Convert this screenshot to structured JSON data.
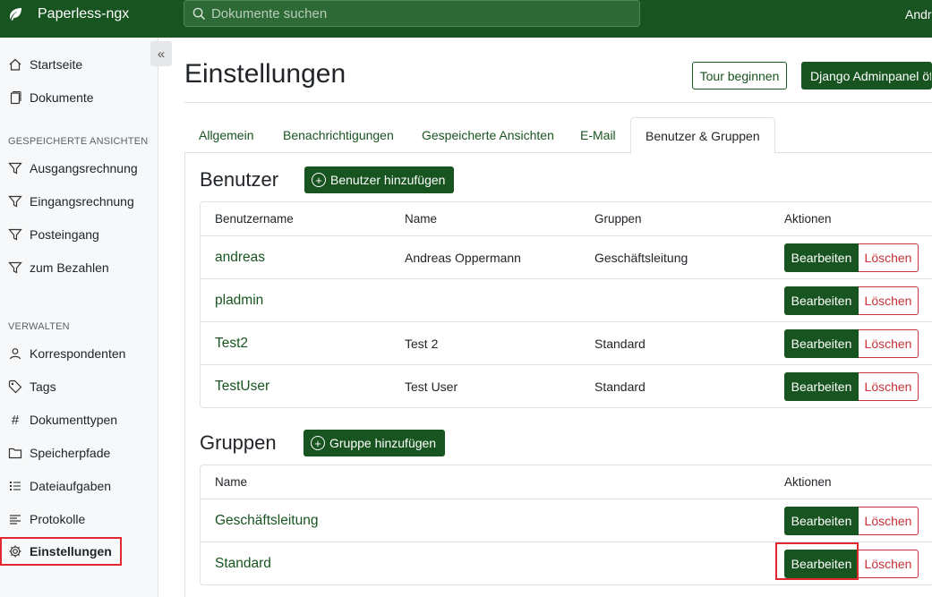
{
  "app": {
    "name": "Paperless-ngx",
    "user_label": "Andreas"
  },
  "search": {
    "placeholder": "Dokumente suchen"
  },
  "sidebar": {
    "top_items": [
      {
        "label": "Startseite",
        "icon": "house-icon"
      },
      {
        "label": "Dokumente",
        "icon": "files-icon"
      }
    ],
    "saved_views_heading": "GESPEICHERTE ANSICHTEN",
    "saved_views": [
      {
        "label": "Ausgangsrechnung",
        "icon": "funnel-icon"
      },
      {
        "label": "Eingangsrechnung",
        "icon": "funnel-icon"
      },
      {
        "label": "Posteingang",
        "icon": "funnel-icon"
      },
      {
        "label": "zum Bezahlen",
        "icon": "funnel-icon"
      }
    ],
    "manage_heading": "VERWALTEN",
    "manage": [
      {
        "label": "Korrespondenten",
        "icon": "person-icon"
      },
      {
        "label": "Tags",
        "icon": "tag-icon"
      },
      {
        "label": "Dokumenttypen",
        "icon": "hash-icon"
      },
      {
        "label": "Speicherpfade",
        "icon": "folder-icon"
      },
      {
        "label": "Dateiaufgaben",
        "icon": "list-task-icon"
      },
      {
        "label": "Protokolle",
        "icon": "text-left-icon"
      },
      {
        "label": "Einstellungen",
        "icon": "gear-icon",
        "active": true
      }
    ],
    "collapse_icon": "chevron-double-left-icon"
  },
  "page": {
    "title": "Einstellungen",
    "tour_button": "Tour beginnen",
    "admin_button": "Django Adminpanel öffnen"
  },
  "tabs": [
    {
      "label": "Allgemein"
    },
    {
      "label": "Benachrichtigungen"
    },
    {
      "label": "Gespeicherte Ansichten"
    },
    {
      "label": "E-Mail"
    },
    {
      "label": "Benutzer & Gruppen",
      "active": true
    }
  ],
  "users": {
    "title": "Benutzer",
    "add_button": "Benutzer hinzufügen",
    "columns": [
      "Benutzername",
      "Name",
      "Gruppen",
      "Aktionen"
    ],
    "rows": [
      {
        "username": "andreas",
        "name": "Andreas Oppermann",
        "groups": "Geschäftsleitung"
      },
      {
        "username": "pladmin",
        "name": "",
        "groups": ""
      },
      {
        "username": "Test2",
        "name": "Test 2",
        "groups": "Standard"
      },
      {
        "username": "TestUser",
        "name": "Test User",
        "groups": "Standard"
      }
    ]
  },
  "groups": {
    "title": "Gruppen",
    "add_button": "Gruppe hinzufügen",
    "columns": [
      "Name",
      "Aktionen"
    ],
    "rows": [
      {
        "name": "Geschäftsleitung"
      },
      {
        "name": "Standard"
      }
    ]
  },
  "actions": {
    "edit": "Bearbeiten",
    "delete": "Löschen"
  },
  "colors": {
    "brand": "#17541f",
    "danger": "#c8323a",
    "highlight": "#e0282e"
  }
}
